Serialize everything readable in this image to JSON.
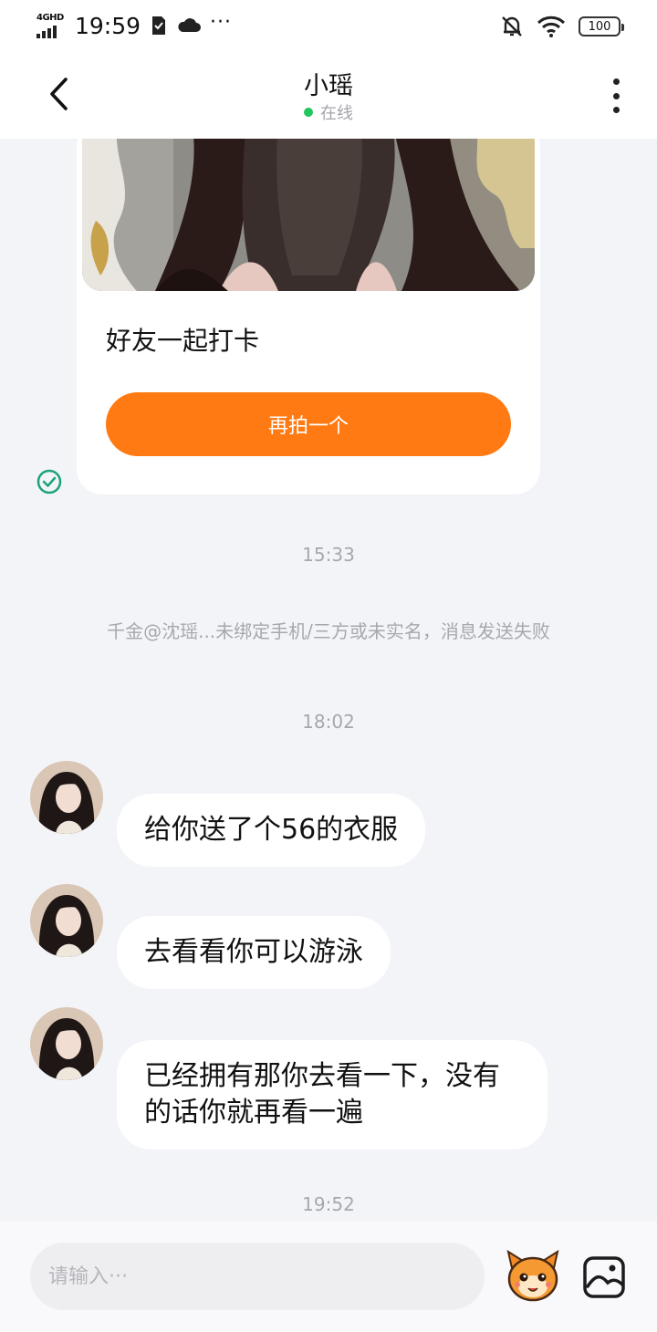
{
  "status_bar": {
    "network": "4GHD",
    "time": "19:59",
    "more": "···",
    "battery": "100"
  },
  "header": {
    "title": "小瑶",
    "status": "在线",
    "status_color": "#22c55e"
  },
  "card": {
    "text": "好友一起打卡",
    "button_label": "再拍一个",
    "button_color": "#ff7a12"
  },
  "messages": {
    "time_1": "15:33",
    "system_notice": "千金@沈瑶...未绑定手机/三方或未实名，消息发送失败",
    "time_2": "18:02",
    "bubble_1": "给你送了个56的衣服",
    "bubble_2": "去看看你可以游泳",
    "bubble_3_line_1": "已经拥有那你去看一下，没有",
    "bubble_3_line_2": "的话你就再看一遍",
    "time_3": "19:52"
  },
  "input": {
    "placeholder": "请输入···"
  },
  "icons": {
    "back": "chevron-left-icon",
    "more": "more-vertical-icon",
    "sent": "check-circle-icon",
    "emoji": "emoji-mascot-icon",
    "image": "image-icon"
  }
}
